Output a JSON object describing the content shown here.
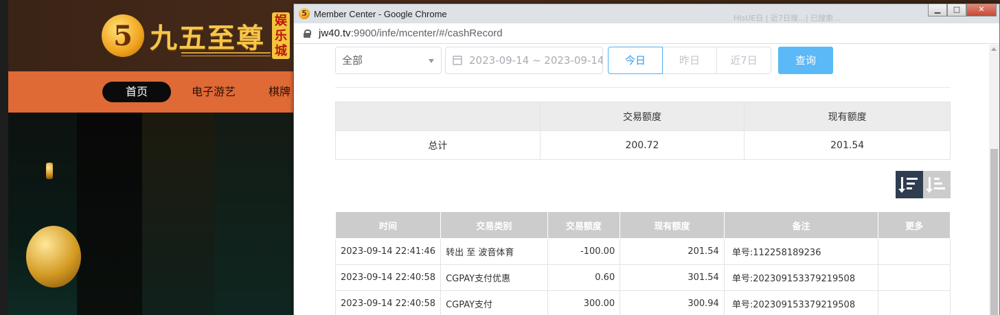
{
  "site": {
    "logo_glyph": "5",
    "logo_name": "九五至尊",
    "logo_badge": [
      "娱",
      "乐",
      "城"
    ],
    "nav": [
      {
        "label": "首页",
        "active": true
      },
      {
        "label": "电子游艺",
        "active": false
      },
      {
        "label": "棋牌",
        "active": false
      }
    ],
    "colors": {
      "nav_bg": "#e06a36",
      "header_bg": "#3a2416",
      "gold": "#f5c64a"
    }
  },
  "window": {
    "title": "Member Center - Google Chrome",
    "favicon": "5",
    "controls": {
      "minimize": "▁",
      "maximize": "□",
      "close": "✕"
    },
    "faint_title": "HIsUE日 | 近7日搜…| 已搜索…",
    "url_host": "jw40.tv",
    "url_path": ":9900/infe/mcenter/#/cashRecord"
  },
  "filters": {
    "type_select": "全部",
    "date_range": "2023-09-14 ~ 2023-09-14",
    "quick_ranges": [
      {
        "label": "今日",
        "active": true
      },
      {
        "label": "昨日",
        "active": false
      },
      {
        "label": "近7日",
        "active": false
      }
    ],
    "query_label": "查询",
    "colors": {
      "active": "#2f9de8",
      "query_bg": "#5bb9f7"
    }
  },
  "summary": {
    "headers": [
      "",
      "交易额度",
      "现有额度"
    ],
    "row": {
      "label": "总计",
      "amount": "200.72",
      "balance": "201.54"
    }
  },
  "sort": {
    "desc_active": true,
    "colors": {
      "active": "#2e3d50",
      "inactive": "#cccccc"
    }
  },
  "records": {
    "headers": [
      "时间",
      "交易类别",
      "交易额度",
      "现有额度",
      "备注",
      "更多"
    ],
    "rows": [
      {
        "time": "2023-09-14 22:41:46",
        "type": "转出 至 波音体育",
        "amount": "-100.00",
        "balance": "201.54",
        "note": "单号:112258189236",
        "more": ""
      },
      {
        "time": "2023-09-14 22:40:58",
        "type": "CGPAY支付优惠",
        "amount": "0.60",
        "balance": "301.54",
        "note": "单号:202309153379219508",
        "more": ""
      },
      {
        "time": "2023-09-14 22:40:58",
        "type": "CGPAY支付",
        "amount": "300.00",
        "balance": "300.94",
        "note": "单号:202309153379219508",
        "more": ""
      }
    ]
  }
}
